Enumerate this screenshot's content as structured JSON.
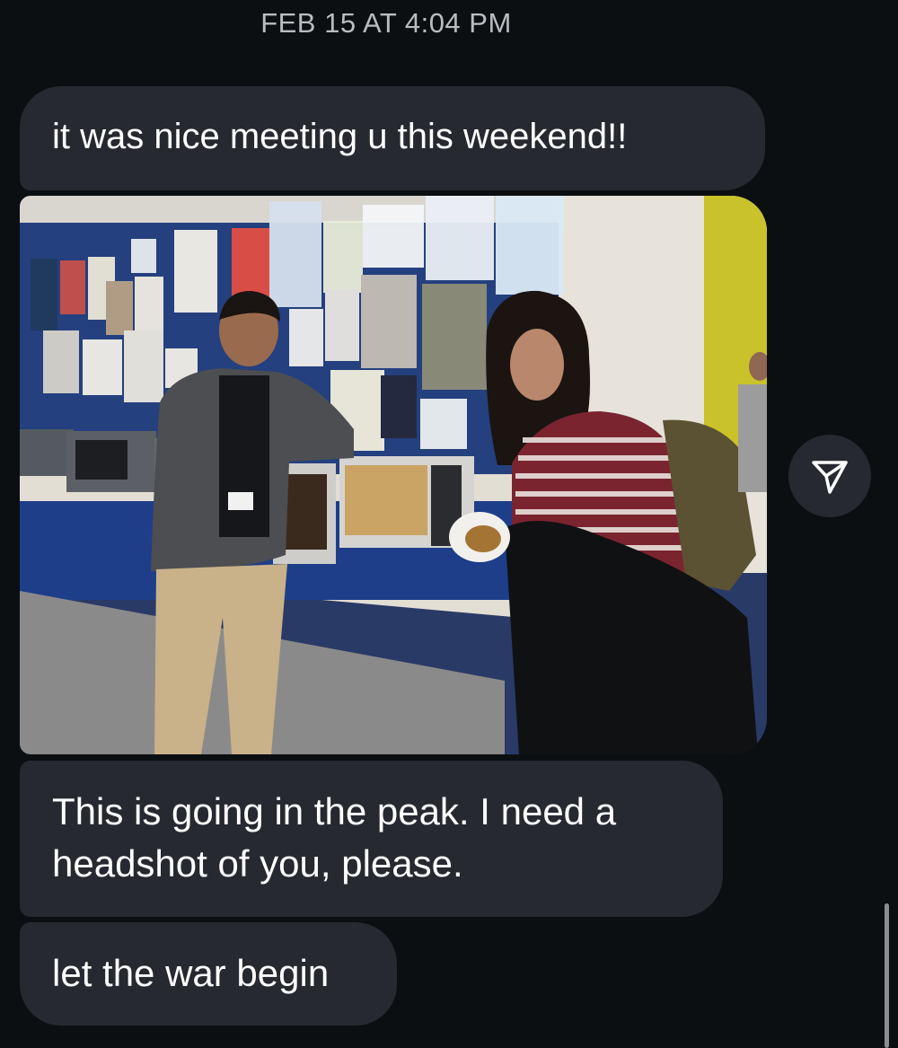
{
  "header": {
    "timestamp": "FEB 15 AT 4:04 PM"
  },
  "messages": [
    {
      "type": "text",
      "text": "it was nice meeting u this weekend!!"
    },
    {
      "type": "photo",
      "description_icon": "photo-attachment"
    },
    {
      "type": "text",
      "text": "This is going in the peak. I need a headshot of you, please."
    },
    {
      "type": "text",
      "text": "let the war begin"
    }
  ],
  "actions": {
    "share_icon": "paper-plane-icon"
  },
  "colors": {
    "background": "#0c0f12",
    "bubble": "#26292f",
    "timestamp_text": "#b9bcc1",
    "message_text": "#ffffff"
  }
}
